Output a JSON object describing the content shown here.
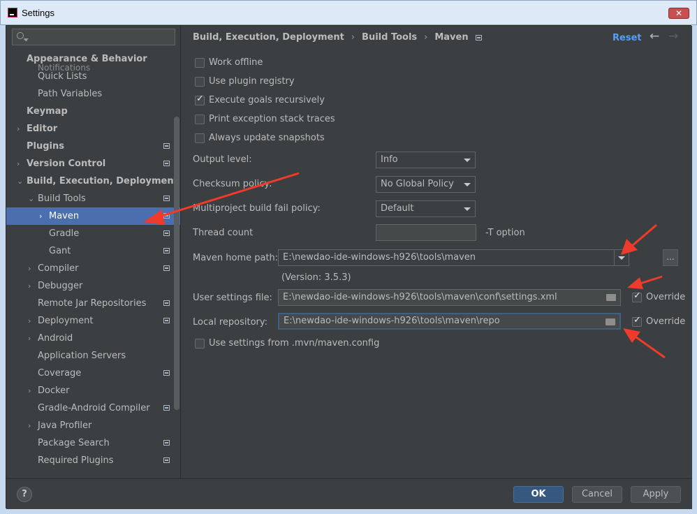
{
  "window": {
    "title": "Settings",
    "close_glyph": "✕"
  },
  "sidebar": {
    "search": {
      "placeholder": ""
    },
    "partial_item": "Notifications",
    "items": [
      {
        "label": "Appearance & Behavior",
        "bold": true,
        "arrow": "",
        "has_icon": false,
        "indent": 0
      },
      {
        "label": "Quick Lists",
        "bold": false,
        "arrow": "",
        "has_icon": false,
        "indent": 1
      },
      {
        "label": "Path Variables",
        "bold": false,
        "arrow": "",
        "has_icon": false,
        "indent": 1
      },
      {
        "label": "Keymap",
        "bold": true,
        "arrow": "",
        "has_icon": false,
        "indent": 0
      },
      {
        "label": "Editor",
        "bold": true,
        "arrow": "›",
        "has_icon": false,
        "indent": 0
      },
      {
        "label": "Plugins",
        "bold": true,
        "arrow": "",
        "has_icon": true,
        "indent": 0
      },
      {
        "label": "Version Control",
        "bold": true,
        "arrow": "›",
        "has_icon": true,
        "indent": 0
      },
      {
        "label": "Build, Execution, Deployment",
        "bold": true,
        "arrow": "⌄",
        "has_icon": false,
        "indent": 0
      },
      {
        "label": "Build Tools",
        "bold": false,
        "arrow": "⌄",
        "has_icon": true,
        "indent": 1
      },
      {
        "label": "Maven",
        "bold": false,
        "arrow": "›",
        "has_icon": true,
        "indent": 2,
        "selected": true
      },
      {
        "label": "Gradle",
        "bold": false,
        "arrow": "",
        "has_icon": true,
        "indent": 2
      },
      {
        "label": "Gant",
        "bold": false,
        "arrow": "",
        "has_icon": true,
        "indent": 2
      },
      {
        "label": "Compiler",
        "bold": false,
        "arrow": "›",
        "has_icon": true,
        "indent": 1
      },
      {
        "label": "Debugger",
        "bold": false,
        "arrow": "›",
        "has_icon": false,
        "indent": 1
      },
      {
        "label": "Remote Jar Repositories",
        "bold": false,
        "arrow": "",
        "has_icon": true,
        "indent": 1
      },
      {
        "label": "Deployment",
        "bold": false,
        "arrow": "›",
        "has_icon": true,
        "indent": 1
      },
      {
        "label": "Android",
        "bold": false,
        "arrow": "›",
        "has_icon": false,
        "indent": 1
      },
      {
        "label": "Application Servers",
        "bold": false,
        "arrow": "",
        "has_icon": false,
        "indent": 1
      },
      {
        "label": "Coverage",
        "bold": false,
        "arrow": "",
        "has_icon": true,
        "indent": 1
      },
      {
        "label": "Docker",
        "bold": false,
        "arrow": "›",
        "has_icon": false,
        "indent": 1
      },
      {
        "label": "Gradle-Android Compiler",
        "bold": false,
        "arrow": "",
        "has_icon": true,
        "indent": 1
      },
      {
        "label": "Java Profiler",
        "bold": false,
        "arrow": "›",
        "has_icon": false,
        "indent": 1
      },
      {
        "label": "Package Search",
        "bold": false,
        "arrow": "",
        "has_icon": true,
        "indent": 1
      },
      {
        "label": "Required Plugins",
        "bold": false,
        "arrow": "",
        "has_icon": true,
        "indent": 1
      }
    ]
  },
  "header": {
    "breadcrumb": [
      "Build, Execution, Deployment",
      "Build Tools",
      "Maven"
    ],
    "separator": "›",
    "reset_label": "Reset",
    "back_glyph": "←",
    "forward_glyph": "→"
  },
  "maven": {
    "checkboxes": [
      {
        "label": "Work offline",
        "checked": false
      },
      {
        "label": "Use plugin registry",
        "checked": false
      },
      {
        "label": "Execute goals recursively",
        "checked": true
      },
      {
        "label": "Print exception stack traces",
        "checked": false
      },
      {
        "label": "Always update snapshots",
        "checked": false
      }
    ],
    "output_level": {
      "label": "Output level:",
      "value": "Info"
    },
    "checksum_policy": {
      "label": "Checksum policy:",
      "value": "No Global Policy"
    },
    "fail_policy": {
      "label": "Multiproject build fail policy:",
      "value": "Default"
    },
    "thread_count": {
      "label": "Thread count",
      "value": "",
      "suffix": "-T option"
    },
    "home_path": {
      "label": "Maven home path:",
      "value": "E:\\newdao-ide-windows-h926\\tools\\maven",
      "version": "(Version: 3.5.3)",
      "browse_label": "..."
    },
    "user_settings": {
      "label": "User settings file:",
      "value": "E:\\newdao-ide-windows-h926\\tools\\maven\\conf\\settings.xml",
      "override_label": "Override",
      "override_checked": true
    },
    "local_repo": {
      "label": "Local repository:",
      "value": "E:\\newdao-ide-windows-h926\\tools\\maven\\repo",
      "override_label": "Override",
      "override_checked": true
    },
    "mvn_config": {
      "label": "Use settings from .mvn/maven.config",
      "checked": false
    }
  },
  "footer": {
    "help_label": "?",
    "ok_label": "OK",
    "cancel_label": "Cancel",
    "apply_label": "Apply"
  },
  "colors": {
    "background": "#3c3f41",
    "selection": "#4b6eaf",
    "link": "#589df6",
    "annotation_arrow": "#f03a2b"
  }
}
